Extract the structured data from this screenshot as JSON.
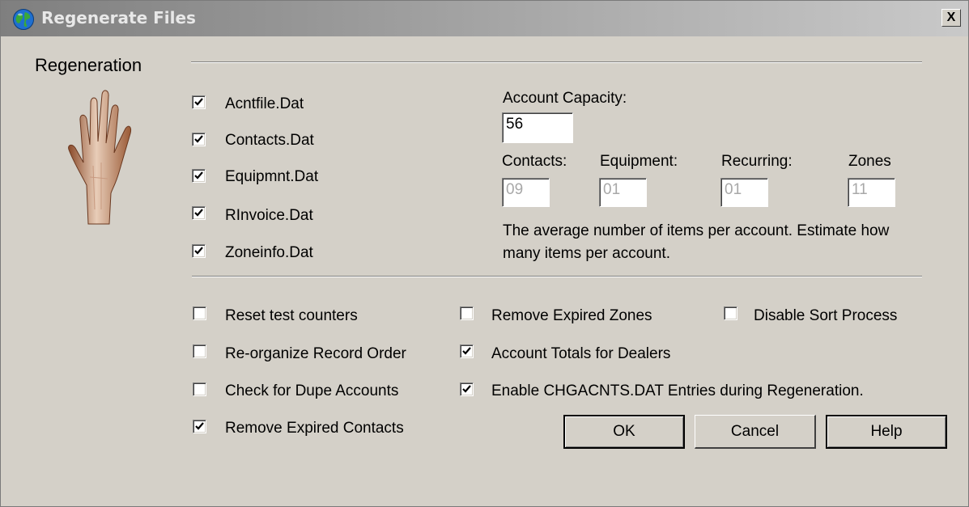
{
  "window": {
    "title": "Regenerate Files",
    "close_label": "X"
  },
  "regeneration": {
    "label": "Regeneration",
    "files": [
      {
        "label": "Acntfile.Dat",
        "checked": true
      },
      {
        "label": "Contacts.Dat",
        "checked": true
      },
      {
        "label": "Equipmnt.Dat",
        "checked": true
      },
      {
        "label": "RInvoice.Dat",
        "checked": true
      },
      {
        "label": "Zoneinfo.Dat",
        "checked": true
      }
    ]
  },
  "capacity": {
    "label": "Account Capacity:",
    "value": "56",
    "fields": [
      {
        "label": "Contacts:",
        "value": "09"
      },
      {
        "label": "Equipment:",
        "value": "01"
      },
      {
        "label": "Recurring:",
        "value": "01"
      },
      {
        "label": "Zones",
        "value": "11"
      }
    ],
    "note_line1": "The average number of items per account.  Estimate how",
    "note_line2": "many items per account."
  },
  "options": [
    {
      "label": "Reset test counters",
      "checked": false
    },
    {
      "label": "Re-organize Record Order",
      "checked": false
    },
    {
      "label": "Check for Dupe Accounts",
      "checked": false
    },
    {
      "label": "Remove Expired Contacts",
      "checked": true
    },
    {
      "label": "Remove Expired Zones",
      "checked": false
    },
    {
      "label": "Account Totals for Dealers",
      "checked": true
    },
    {
      "label": "Enable CHGACNTS.DAT Entries during Regeneration.",
      "checked": true
    },
    {
      "label": "Disable Sort Process",
      "checked": false
    }
  ],
  "buttons": {
    "ok": "OK",
    "cancel": "Cancel",
    "help": "Help"
  }
}
